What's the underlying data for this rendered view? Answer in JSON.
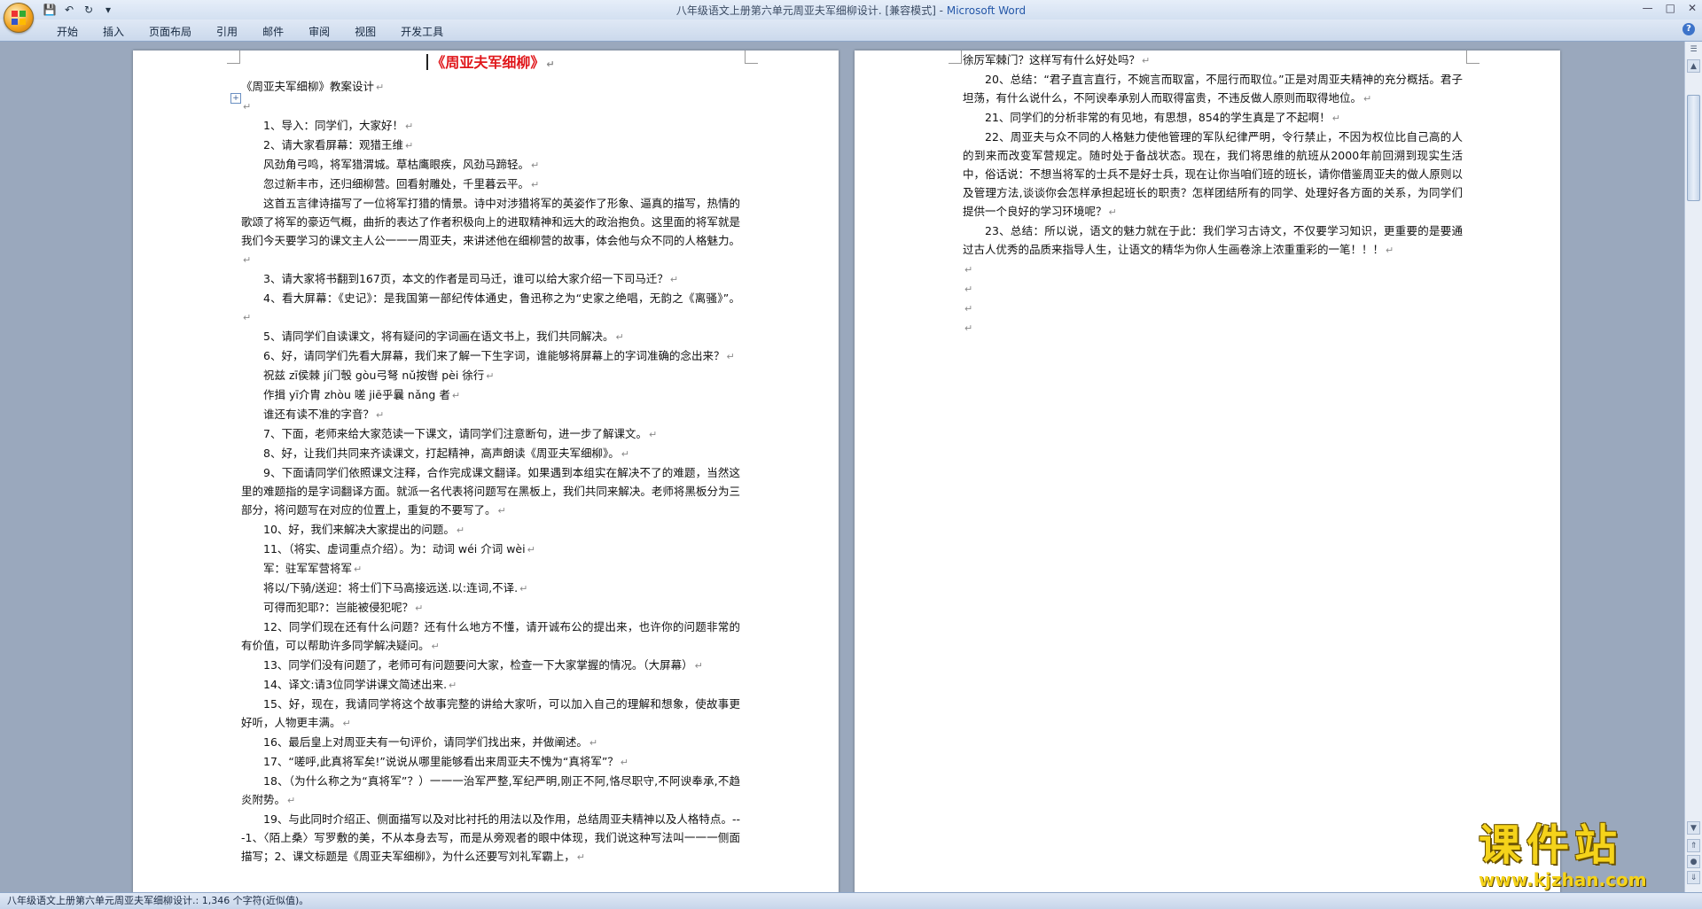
{
  "window": {
    "title": "八年级语文上册第六单元周亚夫军细柳设计. [兼容模式] - ",
    "app_name": "Microsoft Word"
  },
  "qat": {
    "save_icon": "save-icon",
    "undo_icon": "undo-icon",
    "redo_icon": "redo-icon",
    "customize_icon": "qat-dropdown-icon"
  },
  "ribbon_tabs": [
    "开始",
    "插入",
    "页面布局",
    "引用",
    "邮件",
    "审阅",
    "视图",
    "开发工具"
  ],
  "left_page": {
    "title": "《周亚夫军细柳》",
    "lines": [
      {
        "t": "《周亚夫军细柳》教案设计",
        "cls": ""
      },
      {
        "t": "",
        "cls": ""
      },
      {
        "t": "1、导入：同学们，大家好！",
        "cls": "ind"
      },
      {
        "t": "2、请大家看屏幕：观猎王维",
        "cls": "ind"
      },
      {
        "t": "风劲角弓鸣，将军猎渭城。草枯鹰眼疾，风劲马蹄轻。",
        "cls": "ind"
      },
      {
        "t": "忽过新丰市，还归细柳营。回看射雕处，千里暮云平。",
        "cls": "ind"
      },
      {
        "t": "这首五言律诗描写了一位将军打猎的情景。诗中对涉猎将军的英姿作了形象、逼真的描写，热情的歌颂了将军的豪迈气概，曲折的表达了作者积极向上的进取精神和远大的政治抱负。这里面的将军就是我们今天要学习的课文主人公一一一周亚夫，来讲述他在细柳营的故事，体会他与众不同的人格魅力。",
        "cls": "ind"
      },
      {
        "t": "3、请大家将书翻到167页，本文的作者是司马迁，谁可以给大家介绍一下司马迁？",
        "cls": "ind"
      },
      {
        "t": "4、看大屏幕：《史记》：是我国第一部纪传体通史，鲁迅称之为“史家之绝唱，无韵之《离骚》”。",
        "cls": "ind"
      },
      {
        "t": "5、请同学们自读课文，将有疑问的字词画在语文书上，我们共同解决。",
        "cls": "ind"
      },
      {
        "t": "6、好，请同学们先看大屏幕，我们来了解一下生字词，谁能够将屏幕上的字词准确的念出来？",
        "cls": "ind"
      },
      {
        "t": "祝兹 zī侯棘 jí门彀 gòu弓弩 nǔ按辔 pèi 徐行",
        "cls": "ind"
      },
      {
        "t": "作揖 yī介胄 zhòu 嗟 jiē乎曩 nǎng 者",
        "cls": "ind"
      },
      {
        "t": "谁还有读不准的字音？",
        "cls": "ind"
      },
      {
        "t": "7、下面，老师来给大家范读一下课文，请同学们注意断句，进一步了解课文。",
        "cls": "ind"
      },
      {
        "t": "8、好，让我们共同来齐读课文，打起精神，高声朗读《周亚夫军细柳》。",
        "cls": "ind"
      },
      {
        "t": "9、下面请同学们依照课文注释，合作完成课文翻译。如果遇到本组实在解决不了的难题，当然这里的难题指的是字词翻译方面。就派一名代表将问题写在黑板上，我们共同来解决。老师将黑板分为三部分，将问题写在对应的位置上，重复的不要写了。",
        "cls": "ind"
      },
      {
        "t": "10、好，我们来解决大家提出的问题。",
        "cls": "ind"
      },
      {
        "t": "11、（将实、虚词重点介绍）。为：动词 wéi 介词 wèi",
        "cls": "ind"
      },
      {
        "t": "军：驻军军营将军",
        "cls": "ind"
      },
      {
        "t": "将以/下骑/送迎：将士们下马高接远送.以:连词,不译.",
        "cls": "ind"
      },
      {
        "t": "可得而犯耶?：岂能被侵犯呢？",
        "cls": "ind"
      },
      {
        "t": "12、同学们现在还有什么问题？还有什么地方不懂，请开诚布公的提出来，也许你的问题非常的有价值，可以帮助许多同学解决疑问。",
        "cls": "ind"
      },
      {
        "t": "13、同学们没有问题了，老师可有问题要问大家，检查一下大家掌握的情况。（大屏幕）",
        "cls": "ind"
      },
      {
        "t": "14、译文:请3位同学讲课文简述出来.",
        "cls": "ind"
      },
      {
        "t": "15、好，现在，我请同学将这个故事完整的讲给大家听，可以加入自己的理解和想象，使故事更好听，人物更丰满。",
        "cls": "ind"
      },
      {
        "t": "16、最后皇上对周亚夫有一句评价，请同学们找出来，并做阐述。",
        "cls": "ind"
      },
      {
        "t": "17、“嗟呼,此真将军矣!”说说从哪里能够看出来周亚夫不愧为“真将军”？",
        "cls": "ind"
      },
      {
        "t": "18、（为什么称之为“真将军”？）一一一治军严整,军纪严明,刚正不阿,恪尽职守,不阿谀奉承,不趋炎附势。",
        "cls": "ind"
      },
      {
        "t": "19、与此同时介绍正、侧面描写以及对比衬托的用法以及作用，总结周亚夫精神以及人格特点。---1、〈陌上桑〉写罗敷的美，不从本身去写，而是从旁观者的眼中体现，我们说这种写法叫一一一侧面描写；2、课文标题是《周亚夫军细柳》，为什么还要写刘礼军霸上，",
        "cls": "ind"
      }
    ]
  },
  "right_page": {
    "lines": [
      {
        "t": "徐厉军棘门？这样写有什么好处吗？",
        "cls": ""
      },
      {
        "t": "20、总结：“君子直言直行，不婉言而取富，不屈行而取位。”正是对周亚夫精神的充分概括。君子坦荡，有什么说什么，不阿谀奉承别人而取得富贵，不违反做人原则而取得地位。",
        "cls": "ind"
      },
      {
        "t": "21、同学们的分析非常的有见地，有思想，854的学生真是了不起啊！",
        "cls": "ind"
      },
      {
        "t": "22、周亚夫与众不同的人格魅力使他管理的军队纪律严明，令行禁止，不因为权位比自己高的人的到来而改变军营规定。随时处于备战状态。现在，我们将思维的航班从2000年前回溯到现实生活中，俗话说：不想当将军的士兵不是好士兵，现在让你当咱们班的班长，请你借鉴周亚夫的做人原则以及管理方法,谈谈你会怎样承担起班长的职责？怎样团结所有的同学、处理好各方面的关系，为同学们提供一个良好的学习环境呢？",
        "cls": "ind"
      },
      {
        "t": "23、总结：所以说，语文的魅力就在于此：我们学习古诗文，不仅要学习知识，更重要的是要通过古人优秀的品质来指导人生，让语文的精华为你人生画卷涂上浓重重彩的一笔！！！",
        "cls": "ind"
      },
      {
        "t": "",
        "cls": ""
      },
      {
        "t": "",
        "cls": ""
      },
      {
        "t": "",
        "cls": ""
      },
      {
        "t": "",
        "cls": ""
      }
    ]
  },
  "statusbar": {
    "text": "八年级语文上册第六单元周亚夫军细柳设计.: 1,346 个字符(近似值)。"
  },
  "watermark": {
    "cn": "课件站",
    "url": "www.kjzhan.com"
  },
  "colors": {
    "title_red": "#e0171b",
    "app_blue": "#2457a8",
    "watermark_yellow": "#f5d31a"
  }
}
